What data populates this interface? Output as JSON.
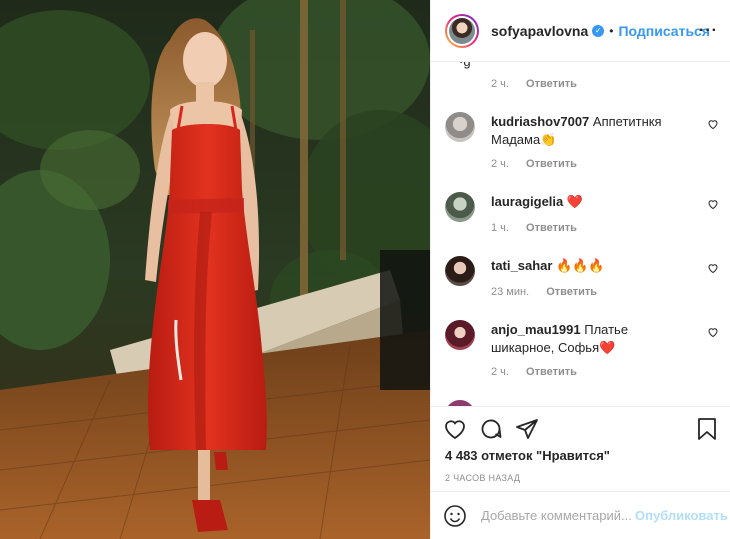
{
  "post": {
    "username": "sofyapavlovna",
    "verified": true,
    "follow_label": "Подписаться",
    "more_icon": "more-options-icon"
  },
  "comments": {
    "stub_text": "·g",
    "stub_time": "2 ч.",
    "reply_label": "Ответить",
    "items": [
      {
        "user": "kudriashov7007",
        "text": "Аппетитнкя Мадама👏",
        "time": "2 ч."
      },
      {
        "user": "lauragigelia",
        "text": "❤️",
        "time": "1 ч."
      },
      {
        "user": "tati_sahar",
        "text": "🔥🔥🔥",
        "time": "23 мин."
      },
      {
        "user": "anjo_mau1991",
        "text": "Платье шикарное, Софья❤️",
        "time": "2 ч."
      }
    ]
  },
  "actions": {
    "likes_text": "4 483 отметок \"Нравится\"",
    "posted_time": "2 часов назад"
  },
  "composer": {
    "placeholder": "Добавьте комментарий...",
    "publish_label": "Опубликовать"
  },
  "colors": {
    "accent": "#3897f0",
    "publish_disabled": "#b2dffc",
    "dress_red": "#d8281b"
  }
}
